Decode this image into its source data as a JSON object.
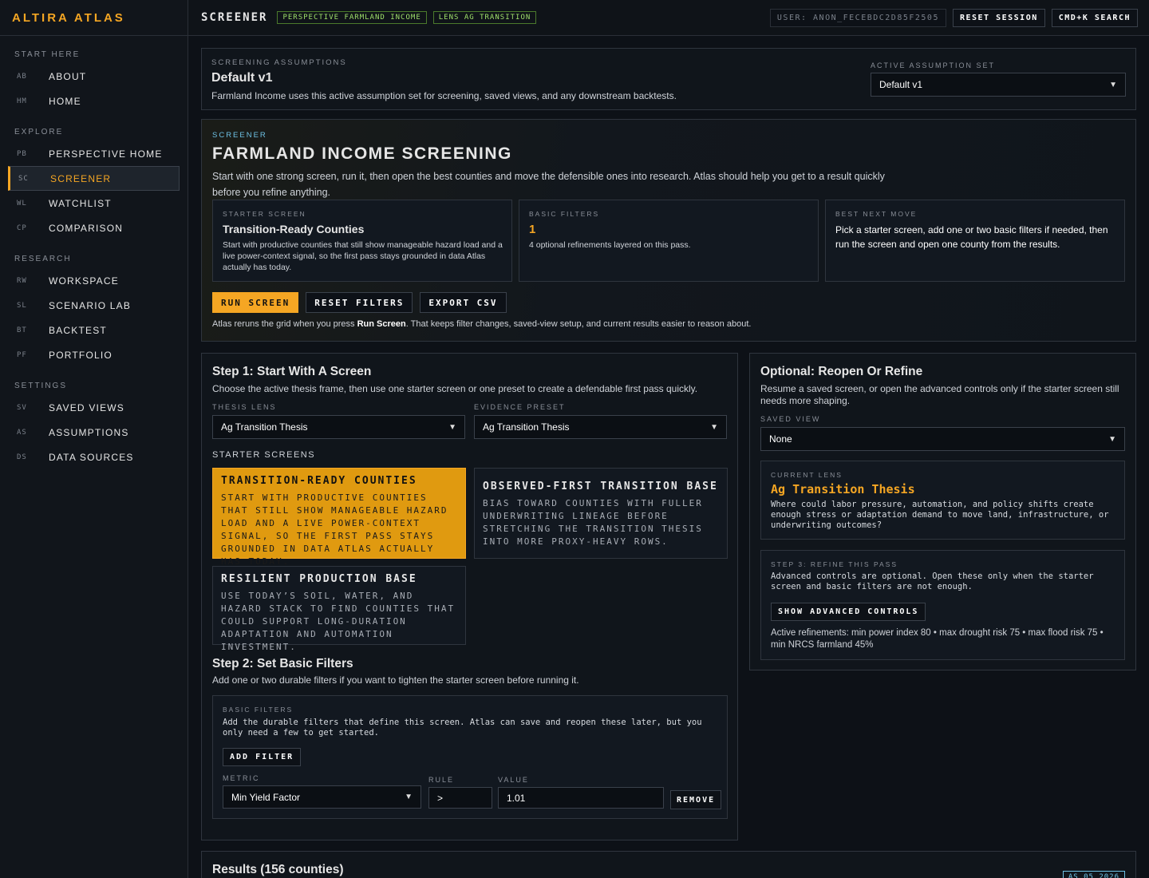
{
  "brand": "ALTIRA ATLAS",
  "sidebar": {
    "sections": [
      {
        "title": "START HERE",
        "items": [
          {
            "code": "AB",
            "label": "ABOUT"
          },
          {
            "code": "HM",
            "label": "HOME"
          }
        ]
      },
      {
        "title": "EXPLORE",
        "items": [
          {
            "code": "PB",
            "label": "PERSPECTIVE HOME"
          },
          {
            "code": "SC",
            "label": "SCREENER"
          },
          {
            "code": "WL",
            "label": "WATCHLIST"
          },
          {
            "code": "CP",
            "label": "COMPARISON"
          }
        ]
      },
      {
        "title": "RESEARCH",
        "items": [
          {
            "code": "RW",
            "label": "WORKSPACE"
          },
          {
            "code": "SL",
            "label": "SCENARIO LAB"
          },
          {
            "code": "BT",
            "label": "BACKTEST"
          },
          {
            "code": "PF",
            "label": "PORTFOLIO"
          }
        ]
      },
      {
        "title": "SETTINGS",
        "items": [
          {
            "code": "SV",
            "label": "SAVED VIEWS"
          },
          {
            "code": "AS",
            "label": "ASSUMPTIONS"
          },
          {
            "code": "DS",
            "label": "DATA SOURCES"
          }
        ]
      }
    ],
    "active": "SCREENER"
  },
  "topbar": {
    "title": "SCREENER",
    "tags": [
      "PERSPECTIVE FARMLAND INCOME",
      "LENS AG TRANSITION"
    ],
    "user": "USER: ANON_FECEBDC2D85F2505",
    "reset": "RESET SESSION",
    "search": "CMD+K SEARCH"
  },
  "assumptions": {
    "label": "SCREENING ASSUMPTIONS",
    "title": "Default v1",
    "desc": "Farmland Income uses this active assumption set for screening, saved views, and any downstream backtests.",
    "active_label": "ACTIVE ASSUMPTION SET",
    "active_value": "Default v1"
  },
  "hero": {
    "kicker": "SCREENER",
    "title": "FARMLAND INCOME SCREENING",
    "desc": "Start with one strong screen, run it, then open the best counties and move the defensible ones into research. Atlas should help you get to a result quickly before you refine anything.",
    "cards": [
      {
        "label": "STARTER SCREEN",
        "title": "Transition-Ready Counties",
        "text": "Start with productive counties that still show manageable hazard load and a live power-context signal, so the first pass stays grounded in data Atlas actually has today."
      },
      {
        "label": "BASIC FILTERS",
        "title": "1",
        "text": "4 optional refinements layered on this pass."
      },
      {
        "label": "BEST NEXT MOVE",
        "title": "",
        "text": "Pick a starter screen, add one or two basic filters if needed, then run the screen and open one county from the results."
      }
    ],
    "buttons": {
      "run": "RUN SCREEN",
      "reset": "RESET FILTERS",
      "export": "EXPORT CSV"
    },
    "note_pre": "Atlas reruns the grid when you press ",
    "note_bold": "Run Screen",
    "note_post": ". That keeps filter changes, saved-view setup, and current results easier to reason about."
  },
  "step1": {
    "title": "Step 1: Start With A Screen",
    "desc": "Choose the active thesis frame, then use one starter screen or one preset to create a defendable first pass quickly.",
    "lens_label": "THESIS LENS",
    "lens_value": "Ag Transition Thesis",
    "preset_label": "EVIDENCE PRESET",
    "preset_value": "Ag Transition Thesis",
    "starter_label": "STARTER SCREENS",
    "starters": [
      {
        "title": "TRANSITION-READY COUNTIES",
        "desc": "START WITH PRODUCTIVE COUNTIES THAT STILL SHOW MANAGEABLE HAZARD LOAD AND A LIVE POWER-CONTEXT SIGNAL, SO THE FIRST PASS STAYS GROUNDED IN DATA ATLAS ACTUALLY HAS TODAY."
      },
      {
        "title": "OBSERVED-FIRST TRANSITION BASE",
        "desc": "BIAS TOWARD COUNTIES WITH FULLER UNDERWRITING LINEAGE BEFORE STRETCHING THE TRANSITION THESIS INTO MORE PROXY-HEAVY ROWS."
      },
      {
        "title": "RESILIENT PRODUCTION BASE",
        "desc": "USE TODAY’S SOIL, WATER, AND HAZARD STACK TO FIND COUNTIES THAT COULD SUPPORT LONG-DURATION ADAPTATION AND AUTOMATION INVESTMENT."
      }
    ]
  },
  "step2": {
    "title": "Step 2: Set Basic Filters",
    "desc": "Add one or two durable filters if you want to tighten the starter screen before running it.",
    "box_label": "BASIC FILTERS",
    "box_desc": "Add the durable filters that define this screen. Atlas can save and reopen these later, but you only need a few to get started.",
    "add": "ADD FILTER",
    "metric_label": "METRIC",
    "rule_label": "RULE",
    "value_label": "VALUE",
    "metric": "Min Yield Factor",
    "rule": ">",
    "value": "1.01",
    "remove": "REMOVE"
  },
  "optional": {
    "title": "Optional: Reopen Or Refine",
    "desc": "Resume a saved screen, or open the advanced controls only if the starter screen still needs more shaping.",
    "saved_label": "SAVED VIEW",
    "saved_value": "None",
    "lens_label": "CURRENT LENS",
    "lens_title": "Ag Transition Thesis",
    "lens_desc": "Where could labor pressure, automation, and policy shifts create enough stress or adaptation demand to move land, infrastructure, or underwriting outcomes?",
    "step3_label": "STEP 3: REFINE THIS PASS",
    "step3_desc": "Advanced controls are optional. Open these only when the starter screen and basic filters are not enough.",
    "advanced": "SHOW ADVANCED CONTROLS",
    "refinements": "Active refinements: min power index 80 • max drought risk 75 • max flood risk 75 • min NRCS farmland 45%"
  },
  "results": {
    "title": "Results (156 counties)",
    "badge": "AS 05 2026"
  }
}
